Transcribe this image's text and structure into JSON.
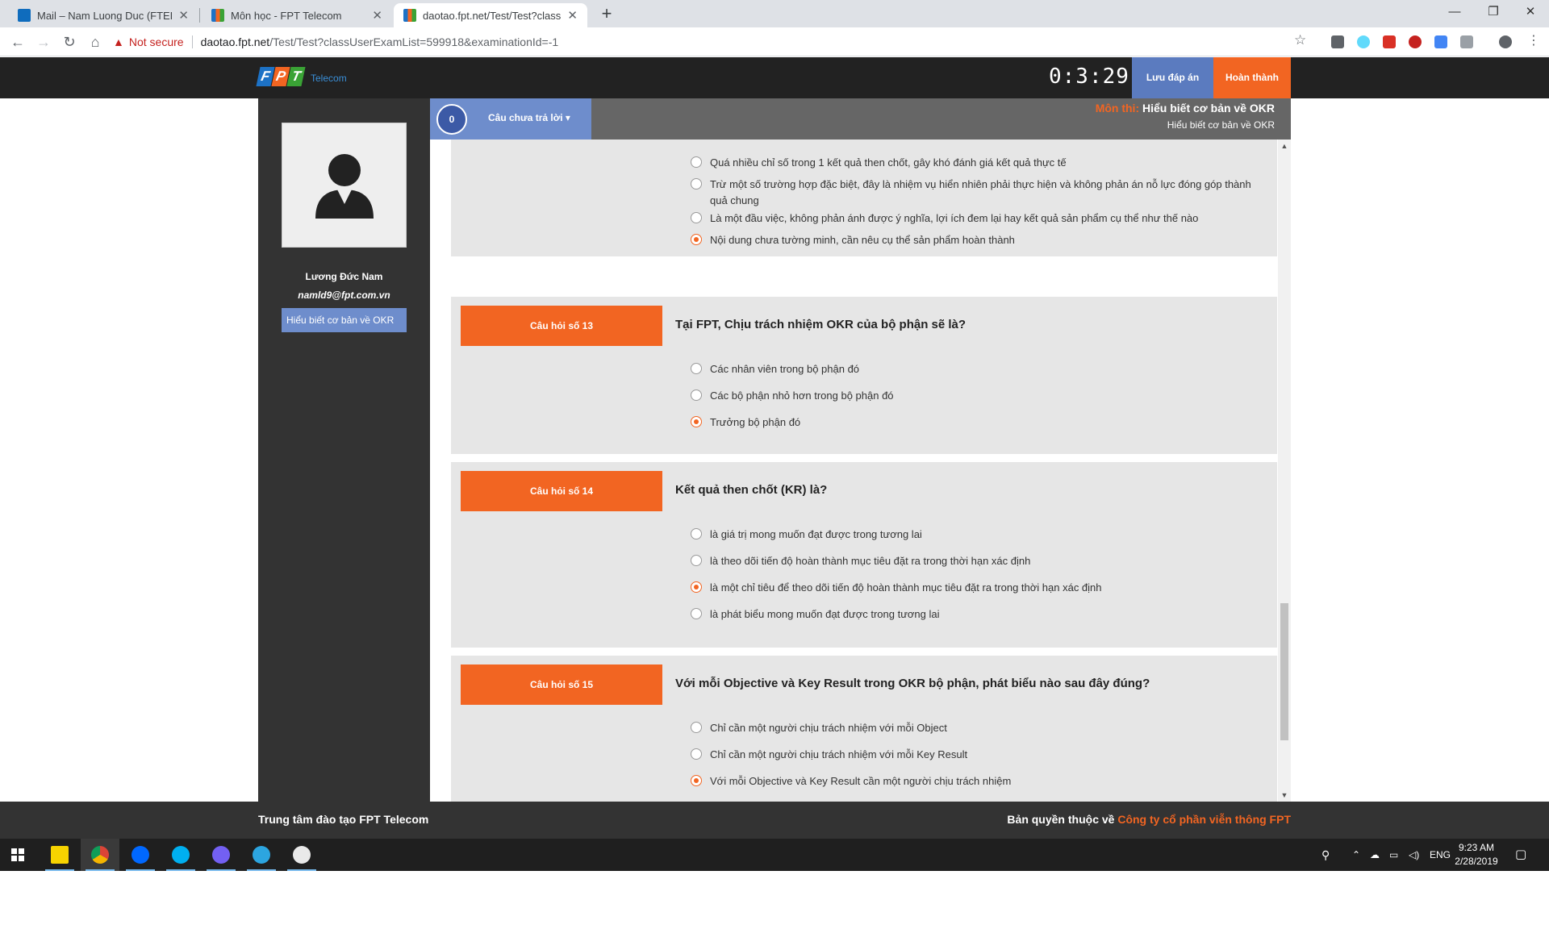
{
  "browser": {
    "tabs": [
      {
        "title": "Mail – Nam Luong Duc (FTEL NC",
        "color": "#0f6cbd"
      },
      {
        "title": "Môn học - FPT Telecom",
        "color": "#f26522"
      },
      {
        "title": "daotao.fpt.net/Test/Test?classUse",
        "color": "#f26522"
      }
    ],
    "new_tab": "+",
    "security_label": "Not secure",
    "url_host": "daotao.fpt.net",
    "url_path": "/Test/Test?classUserExamList=599918&examinationId=-1"
  },
  "header": {
    "logo_letters": [
      "F",
      "P",
      "T"
    ],
    "logo_colors": [
      "#1d72c6",
      "#f26522",
      "#3aa335"
    ],
    "logo_text": "Telecom",
    "timer": "0:3:29",
    "save_label": "Lưu đáp án",
    "finish_label": "Hoàn thành"
  },
  "sidebar": {
    "user_name": "Lương Đức Nam",
    "user_email": "namld9@fpt.com.vn",
    "subject": "Hiểu biết cơ bản về OKR"
  },
  "exam": {
    "unanswered_count": "0",
    "unanswered_label": "Câu chưa trả lời ▾",
    "subject_label": "Môn thi:",
    "subject_name": "Hiểu biết cơ bản về OKR",
    "subject_sub": "Hiểu biết cơ bản về OKR"
  },
  "questions": [
    {
      "head": "",
      "text": "",
      "options": [
        {
          "text": "Quá nhiều chỉ số trong 1 kết quả then chốt, gây khó đánh giá kết quả thực tế",
          "checked": false
        },
        {
          "text": "Trừ một số trường hợp đặc biệt, đây là nhiệm vụ hiển nhiên phải thực hiện và không phản án nỗ lực đóng góp thành quả chung",
          "checked": false
        },
        {
          "text": "Là một đầu việc, không phản ánh được ý nghĩa, lợi ích đem lại hay kết quả sản phẩm cụ thể như thế nào",
          "checked": false
        },
        {
          "text": "Nội dung chưa tường minh, cần nêu cụ thể sản phẩm hoàn thành",
          "checked": true
        }
      ]
    },
    {
      "head": "Câu hỏi số 13",
      "text": "Tại FPT, Chịu trách nhiệm OKR của bộ phận sẽ là?",
      "options": [
        {
          "text": "Các nhân viên trong bộ phận đó",
          "checked": false
        },
        {
          "text": "Các bộ phận nhỏ hơn trong bộ phận đó",
          "checked": false
        },
        {
          "text": "Trưởng bộ phận đó",
          "checked": true
        }
      ]
    },
    {
      "head": "Câu hỏi số 14",
      "text": "Kết quả then chốt (KR) là?",
      "options": [
        {
          "text": "là giá trị mong muốn đạt được trong tương lai",
          "checked": false
        },
        {
          "text": "là theo dõi tiến độ hoàn thành mục tiêu đặt ra trong thời hạn xác định",
          "checked": false
        },
        {
          "text": "là một chỉ tiêu để theo dõi tiến độ hoàn thành mục tiêu đặt ra trong thời hạn xác định",
          "checked": true
        },
        {
          "text": "là phát biểu mong muốn đạt được trong tương lai",
          "checked": false
        }
      ]
    },
    {
      "head": "Câu hỏi số 15",
      "text": "Với mỗi Objective và Key Result trong OKR bộ phận, phát biểu nào sau đây đúng?",
      "options": [
        {
          "text": "Chỉ cần một người chịu trách nhiệm với mỗi Object",
          "checked": false
        },
        {
          "text": "Chỉ cần một người chịu trách nhiệm với mỗi Key Result",
          "checked": false
        },
        {
          "text": "Với mỗi Objective và Key Result cần một người chịu trách nhiệm",
          "checked": true
        }
      ]
    }
  ],
  "footer": {
    "left": "Trung tâm đào tạo FPT Telecom",
    "right_prefix": "Bản quyền thuộc về",
    "right_company": "Công ty cổ phần viễn thông FPT"
  },
  "taskbar": {
    "apps": [
      {
        "name": "sticky-notes",
        "color": "#f7d300"
      },
      {
        "name": "chrome",
        "color": "#db4437"
      },
      {
        "name": "zalo",
        "color": "#0068ff"
      },
      {
        "name": "skype",
        "color": "#00aff0"
      },
      {
        "name": "viber",
        "color": "#7360f2"
      },
      {
        "name": "telegram",
        "color": "#2ca5e0"
      },
      {
        "name": "paint",
        "color": "#e9e9e9"
      }
    ],
    "language": "ENG",
    "time": "9:23 AM",
    "date": "2/28/2019"
  }
}
